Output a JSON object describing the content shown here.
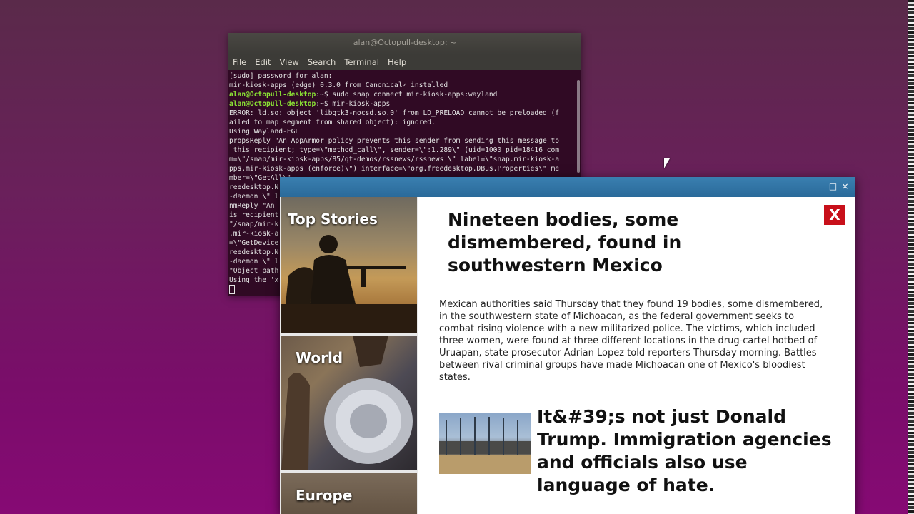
{
  "terminal": {
    "title": "alan@Octopull-desktop: ~",
    "menu": [
      "File",
      "Edit",
      "View",
      "Search",
      "Terminal",
      "Help"
    ],
    "lines": [
      {
        "prompt": "",
        "text": "[sudo] password for alan:"
      },
      {
        "prompt": "",
        "text": "mir-kiosk-apps (edge) 0.3.0 from Canonical✓ installed"
      },
      {
        "prompt": "alan@Octopull-desktop",
        "text": ":~$ sudo snap connect mir-kiosk-apps:wayland"
      },
      {
        "prompt": "alan@Octopull-desktop",
        "text": ":~$ mir-kiosk-apps"
      },
      {
        "prompt": "",
        "text": "ERROR: ld.so: object 'libgtk3-nocsd.so.0' from LD_PRELOAD cannot be preloaded (f"
      },
      {
        "prompt": "",
        "text": "ailed to map segment from shared object): ignored."
      },
      {
        "prompt": "",
        "text": "Using Wayland-EGL"
      },
      {
        "prompt": "",
        "text": "propsReply \"An AppArmor policy prevents this sender from sending this message to"
      },
      {
        "prompt": "",
        "text": " this recipient; type=\\\"method_call\\\", sender=\\\":1.289\\\" (uid=1000 pid=18416 com"
      },
      {
        "prompt": "",
        "text": "m=\\\"/snap/mir-kiosk-apps/85/qt-demos/rssnews/rssnews \\\" label=\\\"snap.mir-kiosk-a"
      },
      {
        "prompt": "",
        "text": "pps.mir-kiosk-apps (enforce)\\\") interface=\\\"org.freedesktop.DBus.Properties\\\" me"
      },
      {
        "prompt": "",
        "text": "mber=\\\"GetAll\\\""
      },
      {
        "prompt": "",
        "text": "reedesktop.N"
      },
      {
        "prompt": "",
        "text": "-daemon \\\" l"
      },
      {
        "prompt": "",
        "text": "nmReply \"An "
      },
      {
        "prompt": "",
        "text": "is recipient"
      },
      {
        "prompt": "",
        "text": "\"/snap/mir-k"
      },
      {
        "prompt": "",
        "text": ".mir-kiosk-a"
      },
      {
        "prompt": "",
        "text": "=\\\"GetDevice"
      },
      {
        "prompt": "",
        "text": "reedesktop.N"
      },
      {
        "prompt": "",
        "text": "-daemon \\\" l"
      },
      {
        "prompt": "",
        "text": "\"Object path"
      },
      {
        "prompt": "",
        "text": "Using the 'x"
      }
    ]
  },
  "kiosk": {
    "controls": {
      "minimize": "_",
      "maximize": "□",
      "close": "×"
    },
    "categories": [
      {
        "label": "Top Stories"
      },
      {
        "label": "World"
      },
      {
        "label": "Europe"
      }
    ],
    "close_label": "X",
    "article": {
      "headline": "Nineteen bodies, some dismembered, found in southwestern Mexico",
      "body": "Mexican authorities said Thursday that they found 19 bodies, some dismembered, in the southwestern state of Michoacan, as the federal government seeks to combat rising violence with a new militarized police. The victims, which included three women, were found at three different locations in the drug-cartel hotbed of Uruapan, state prosecutor Adrian Lopez told reporters Thursday morning. Battles between rival criminal groups have made Michoacan one of Mexico's bloodiest states."
    },
    "second_article": {
      "headline": "It&#39;s not just Donald Trump. Immigration agencies and officials also use language of hate."
    },
    "colors": {
      "titlebar": "#2a6a9a",
      "close_button": "#c8101a",
      "divider": "#2f4ea0"
    }
  }
}
